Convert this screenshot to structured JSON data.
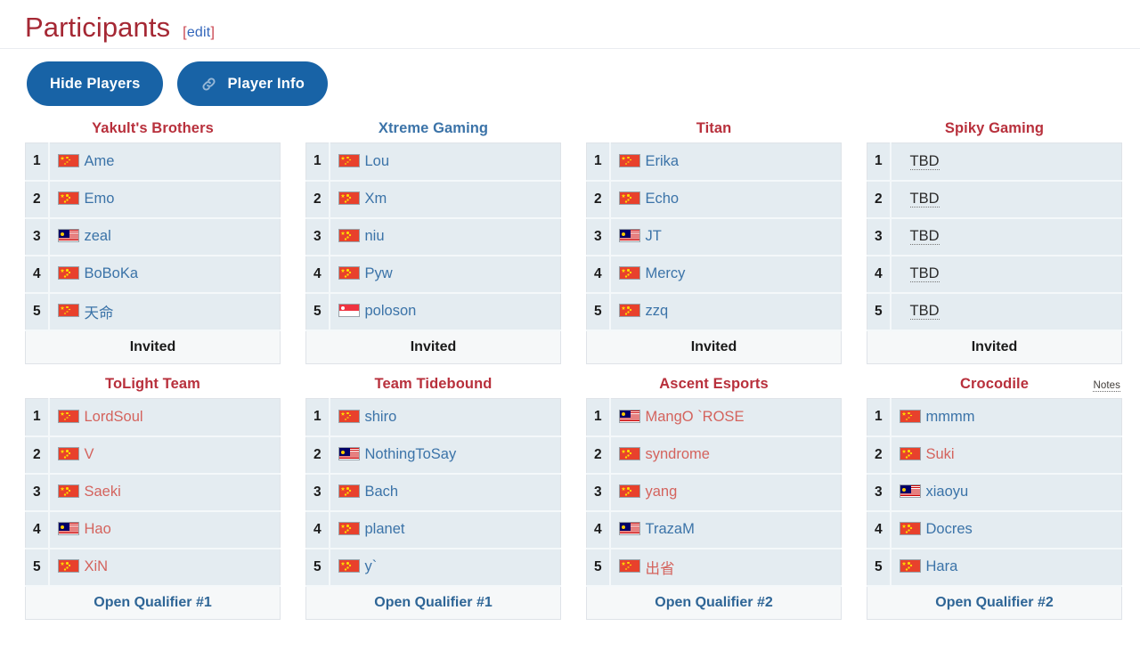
{
  "section": {
    "title": "Participants",
    "edit_open": "[",
    "edit_label": "edit",
    "edit_close": "]"
  },
  "toolbar": {
    "hide_players_label": "Hide Players",
    "player_info_label": "Player Info",
    "player_info_icon": "link-icon"
  },
  "colors": {
    "heading_red": "#a52834",
    "link_blue": "#3b73a8",
    "link_new_red": "#d4635d",
    "button_blue": "#1863a6",
    "row_background": "#e4ecf1",
    "footer_background": "#f6f8f9"
  },
  "teams": [
    {
      "name": "Yakult's Brothers",
      "name_style": "link-new",
      "notes": null,
      "qualification": "Invited",
      "qualification_style": "plain",
      "players": [
        {
          "rank": "1",
          "flag": "cn",
          "name": "Ame",
          "style": "link-exists"
        },
        {
          "rank": "2",
          "flag": "cn",
          "name": "Emo",
          "style": "link-exists"
        },
        {
          "rank": "3",
          "flag": "my",
          "name": "zeal",
          "style": "link-exists"
        },
        {
          "rank": "4",
          "flag": "cn",
          "name": "BoBoKa",
          "style": "link-exists"
        },
        {
          "rank": "5",
          "flag": "cn",
          "name": "天命",
          "style": "link-exists"
        }
      ]
    },
    {
      "name": "Xtreme Gaming",
      "name_style": "link-exists",
      "notes": null,
      "qualification": "Invited",
      "qualification_style": "plain",
      "players": [
        {
          "rank": "1",
          "flag": "cn",
          "name": "Lou",
          "style": "link-exists"
        },
        {
          "rank": "2",
          "flag": "cn",
          "name": "Xm",
          "style": "link-exists"
        },
        {
          "rank": "3",
          "flag": "cn",
          "name": "niu",
          "style": "link-exists"
        },
        {
          "rank": "4",
          "flag": "cn",
          "name": "Pyw",
          "style": "link-exists"
        },
        {
          "rank": "5",
          "flag": "sg",
          "name": "poloson",
          "style": "link-exists"
        }
      ]
    },
    {
      "name": "Titan",
      "name_style": "link-new",
      "notes": null,
      "qualification": "Invited",
      "qualification_style": "plain",
      "players": [
        {
          "rank": "1",
          "flag": "cn",
          "name": "Erika",
          "style": "link-exists"
        },
        {
          "rank": "2",
          "flag": "cn",
          "name": "Echo",
          "style": "link-exists"
        },
        {
          "rank": "3",
          "flag": "my",
          "name": "JT",
          "style": "link-exists"
        },
        {
          "rank": "4",
          "flag": "cn",
          "name": "Mercy",
          "style": "link-exists"
        },
        {
          "rank": "5",
          "flag": "cn",
          "name": "zzq",
          "style": "link-exists"
        }
      ]
    },
    {
      "name": "Spiky Gaming",
      "name_style": "link-new",
      "notes": null,
      "qualification": "Invited",
      "qualification_style": "plain",
      "players": [
        {
          "rank": "1",
          "flag": null,
          "name": "TBD",
          "style": "tbd"
        },
        {
          "rank": "2",
          "flag": null,
          "name": "TBD",
          "style": "tbd"
        },
        {
          "rank": "3",
          "flag": null,
          "name": "TBD",
          "style": "tbd"
        },
        {
          "rank": "4",
          "flag": null,
          "name": "TBD",
          "style": "tbd"
        },
        {
          "rank": "5",
          "flag": null,
          "name": "TBD",
          "style": "tbd"
        }
      ]
    },
    {
      "name": "ToLight Team",
      "name_style": "link-new",
      "notes": null,
      "qualification": "Open Qualifier #1",
      "qualification_style": "link-exists",
      "players": [
        {
          "rank": "1",
          "flag": "cn",
          "name": "LordSoul",
          "style": "link-new"
        },
        {
          "rank": "2",
          "flag": "cn",
          "name": "V",
          "style": "link-new"
        },
        {
          "rank": "3",
          "flag": "cn",
          "name": "Saeki",
          "style": "link-new"
        },
        {
          "rank": "4",
          "flag": "my",
          "name": "Hao",
          "style": "link-new"
        },
        {
          "rank": "5",
          "flag": "cn",
          "name": "XiN",
          "style": "link-new"
        }
      ]
    },
    {
      "name": "Team Tidebound",
      "name_style": "link-new",
      "notes": null,
      "qualification": "Open Qualifier #1",
      "qualification_style": "link-exists",
      "players": [
        {
          "rank": "1",
          "flag": "cn",
          "name": "shiro",
          "style": "link-exists"
        },
        {
          "rank": "2",
          "flag": "my",
          "name": "NothingToSay",
          "style": "link-exists"
        },
        {
          "rank": "3",
          "flag": "cn",
          "name": "Bach",
          "style": "link-exists"
        },
        {
          "rank": "4",
          "flag": "cn",
          "name": "planet",
          "style": "link-exists"
        },
        {
          "rank": "5",
          "flag": "cn",
          "name": "y`",
          "style": "link-exists"
        }
      ]
    },
    {
      "name": "Ascent Esports",
      "name_style": "link-new",
      "notes": null,
      "qualification": "Open Qualifier #2",
      "qualification_style": "link-exists",
      "players": [
        {
          "rank": "1",
          "flag": "my",
          "name": "MangO `ROSE",
          "style": "link-new"
        },
        {
          "rank": "2",
          "flag": "cn",
          "name": "syndrome",
          "style": "link-new"
        },
        {
          "rank": "3",
          "flag": "cn",
          "name": "yang",
          "style": "link-new"
        },
        {
          "rank": "4",
          "flag": "my",
          "name": "TrazaM",
          "style": "link-exists"
        },
        {
          "rank": "5",
          "flag": "cn",
          "name": "出省",
          "style": "link-new"
        }
      ]
    },
    {
      "name": "Crocodile",
      "name_style": "link-new",
      "notes": "Notes",
      "qualification": "Open Qualifier #2",
      "qualification_style": "link-exists",
      "players": [
        {
          "rank": "1",
          "flag": "cn",
          "name": "mmmm",
          "style": "link-exists"
        },
        {
          "rank": "2",
          "flag": "cn",
          "name": "Suki",
          "style": "link-new"
        },
        {
          "rank": "3",
          "flag": "my",
          "name": "xiaoyu",
          "style": "link-exists"
        },
        {
          "rank": "4",
          "flag": "cn",
          "name": "Docres",
          "style": "link-exists"
        },
        {
          "rank": "5",
          "flag": "cn",
          "name": "Hara",
          "style": "link-exists"
        }
      ]
    }
  ]
}
